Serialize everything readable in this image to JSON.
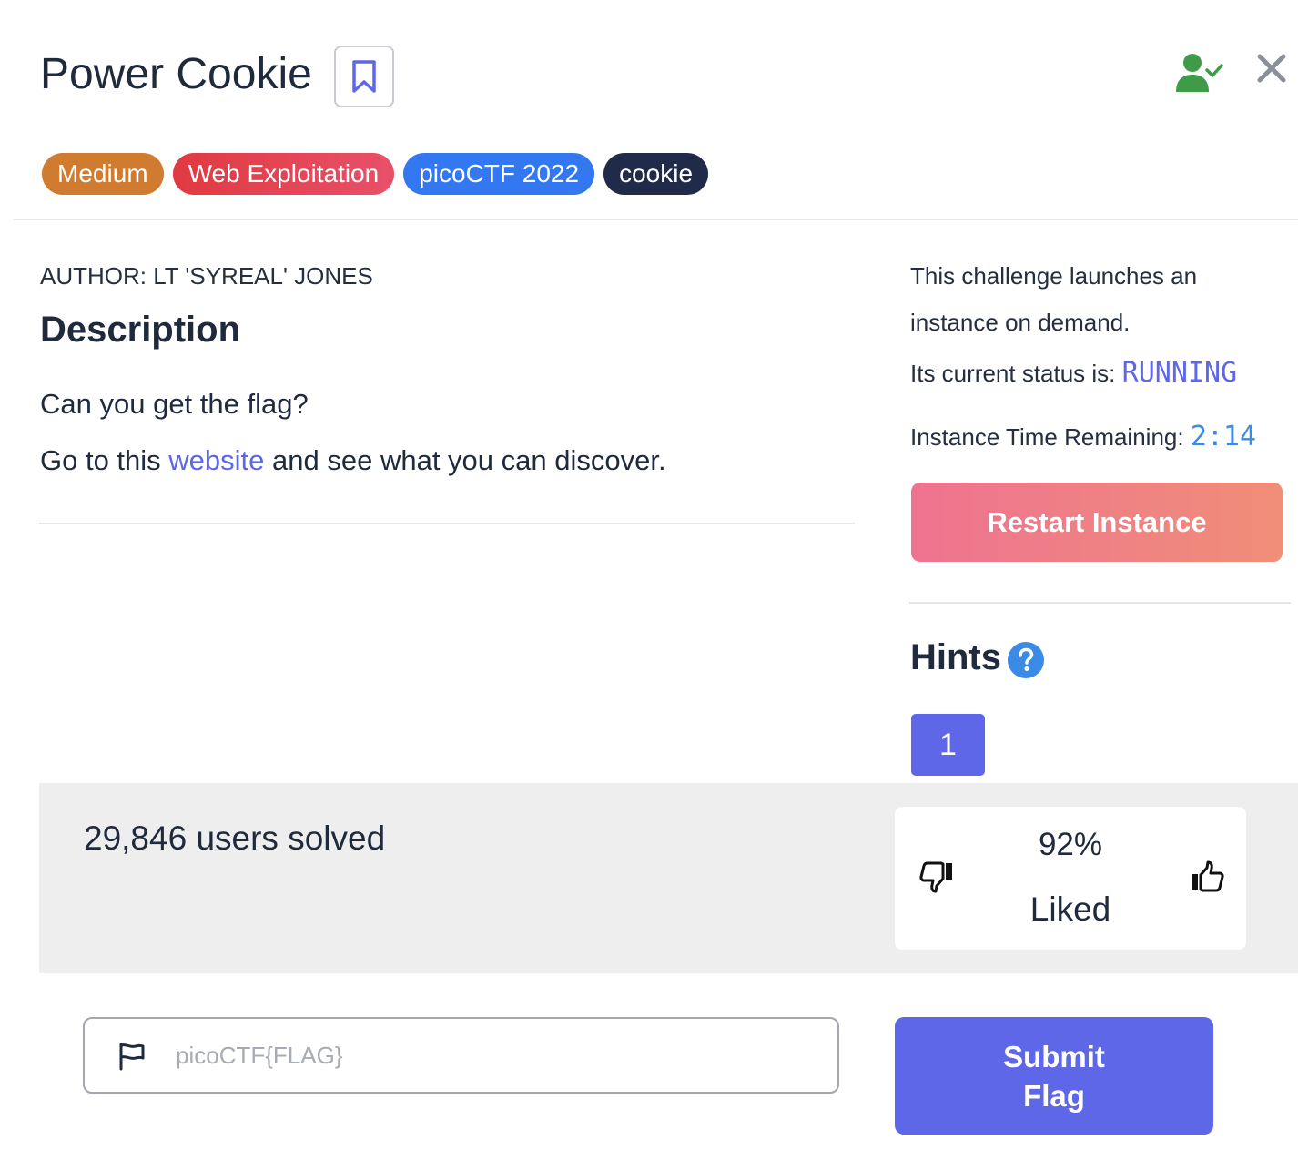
{
  "header": {
    "title": "Power Cookie"
  },
  "tags": [
    {
      "label": "Medium",
      "color": "#cf7b30"
    },
    {
      "label": "Web Exploitation",
      "color": "#e03a40"
    },
    {
      "label": "picoCTF 2022",
      "color": "#3378f0"
    },
    {
      "label": "cookie",
      "color": "#1f2b48"
    }
  ],
  "main": {
    "author": "AUTHOR: LT 'SYREAL' JONES",
    "description_heading": "Description",
    "description_line1": "Can you get the flag?",
    "description_line2_prefix": "Go to this ",
    "description_link": "website",
    "description_line2_suffix": " and see what you can discover."
  },
  "instance": {
    "launch_line1": "This challenge launches an",
    "launch_line2": "instance on demand.",
    "status_label": "Its current status is: ",
    "status_value": "RUNNING",
    "time_label": "Instance Time Remaining: ",
    "time_value": "2:14",
    "restart_label": "Restart Instance"
  },
  "hints": {
    "heading": "Hints",
    "items": [
      "1"
    ]
  },
  "stats": {
    "solved": "29,846 users solved",
    "liked_percent": "92%",
    "liked_label": "Liked"
  },
  "flag_form": {
    "placeholder": "picoCTF{FLAG}",
    "value": "",
    "submit_label": "Submit Flag"
  },
  "colors": {
    "accent": "#5d67e8",
    "user_status": "#3f9b47",
    "restart_gradient_start": "#ee7390",
    "restart_gradient_end": "#f08e78"
  },
  "icons": [
    "bookmark-icon",
    "user-check-icon",
    "close-icon",
    "help-icon",
    "thumbs-down-icon",
    "thumbs-up-icon",
    "flag-icon"
  ]
}
